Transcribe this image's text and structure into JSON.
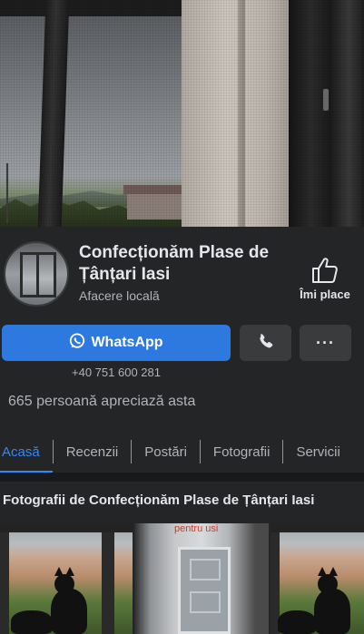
{
  "page": {
    "name": "Confecționăm Plase de Țânțari Iasi",
    "category": "Afacere locală",
    "like_label": "Îmi place",
    "likes_text": "665 persoană apreciază asta"
  },
  "actions": {
    "whatsapp_label": "WhatsApp",
    "phone_number": "+40 751 600 281",
    "more_label": "···"
  },
  "tabs": [
    {
      "label": "Acasă",
      "active": true
    },
    {
      "label": "Recenzii",
      "active": false
    },
    {
      "label": "Postări",
      "active": false
    },
    {
      "label": "Fotografii",
      "active": false
    },
    {
      "label": "Servicii",
      "active": false
    }
  ],
  "photos": {
    "title": "Fotografii de Confecționăm Plase de Țânțari Iasi",
    "items": [
      {
        "caption": ""
      },
      {
        "caption": "pentru usi"
      },
      {
        "caption": ""
      }
    ]
  },
  "colors": {
    "background": "#242526",
    "accent": "#2d79e0",
    "active_tab": "#2d88ff",
    "secondary_button": "#3a3b3c",
    "text_primary": "#e4e6eb",
    "text_secondary": "#b0b3b8"
  }
}
